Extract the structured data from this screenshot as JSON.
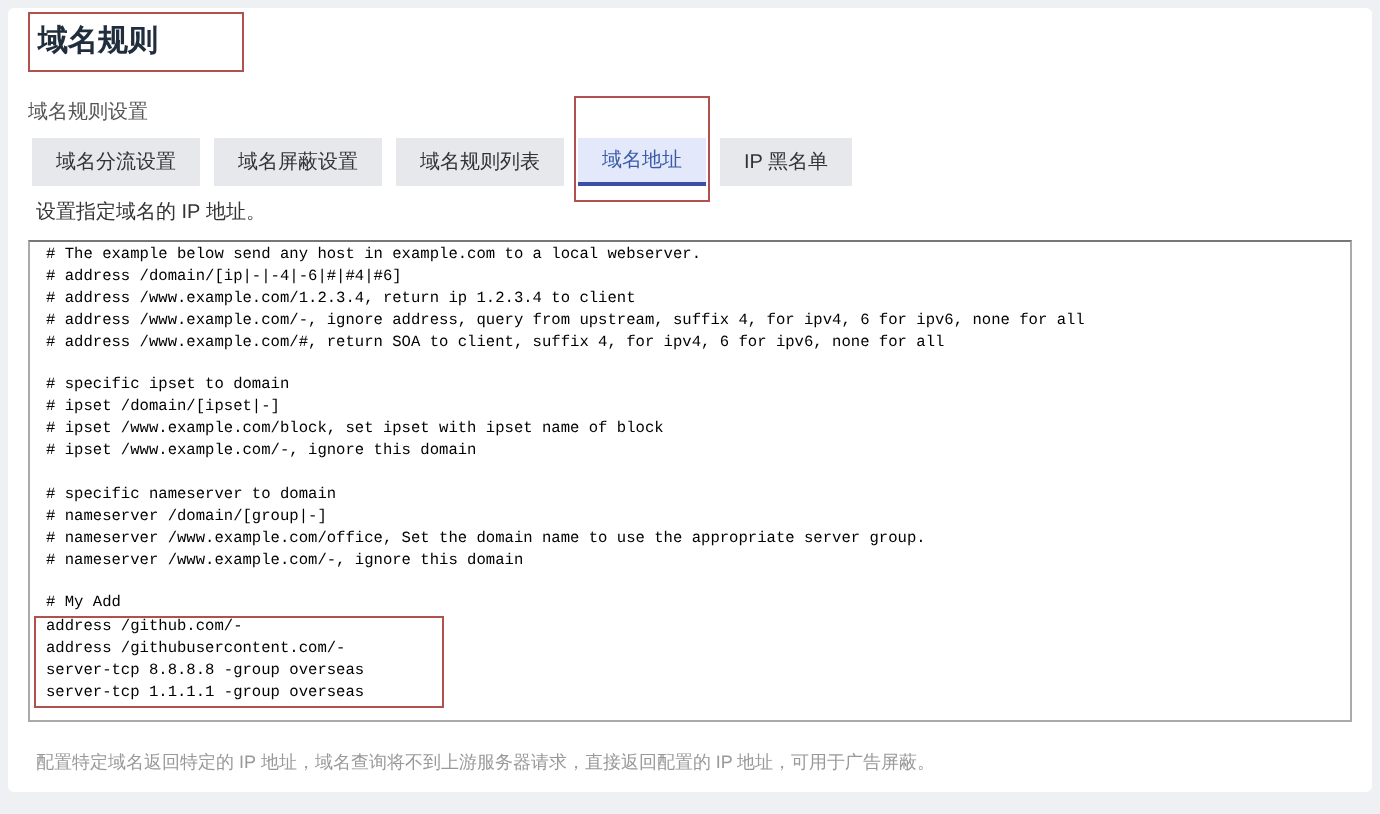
{
  "title": {
    "text": "域名规则",
    "annotated": true
  },
  "section_label": "域名规则设置",
  "tabs": [
    {
      "label": "域名分流设置",
      "selected": false,
      "annotated": false
    },
    {
      "label": "域名屏蔽设置",
      "selected": false,
      "annotated": false
    },
    {
      "label": "域名规则列表",
      "selected": false,
      "annotated": false
    },
    {
      "label": "域名地址",
      "selected": true,
      "annotated": true
    },
    {
      "label": "IP 黑名单",
      "selected": false,
      "annotated": false
    }
  ],
  "description": "设置指定域名的 IP 地址。",
  "editor": {
    "blocks": [
      {
        "blank_line_before": false,
        "annotated": false,
        "lines": [
          "# The example below send any host in example.com to a local webserver.",
          "# address /domain/[ip|-|-4|-6|#|#4|#6]",
          "# address /www.example.com/1.2.3.4, return ip 1.2.3.4 to client",
          "# address /www.example.com/-, ignore address, query from upstream, suffix 4, for ipv4, 6 for ipv6, none for all",
          "# address /www.example.com/#, return SOA to client, suffix 4, for ipv4, 6 for ipv6, none for all"
        ]
      },
      {
        "blank_line_before": true,
        "annotated": false,
        "lines": [
          "# specific ipset to domain",
          "# ipset /domain/[ipset|-]",
          "# ipset /www.example.com/block, set ipset with ipset name of block",
          "# ipset /www.example.com/-, ignore this domain"
        ]
      },
      {
        "blank_line_before": true,
        "annotated": false,
        "lines": [
          "# specific nameserver to domain",
          "# nameserver /domain/[group|-]",
          "# nameserver /www.example.com/office, Set the domain name to use the appropriate server group.",
          "# nameserver /www.example.com/-, ignore this domain"
        ]
      },
      {
        "blank_line_before": true,
        "annotated": false,
        "lines": [
          "# My Add"
        ]
      },
      {
        "blank_line_before": false,
        "annotated": true,
        "lines": [
          "address /github.com/-",
          "address /githubusercontent.com/-",
          "server-tcp 8.8.8.8 -group overseas",
          "server-tcp 1.1.1.1 -group overseas"
        ]
      }
    ]
  },
  "hint": "配置特定域名返回特定的 IP 地址，域名查询将不到上游服务器请求，直接返回配置的 IP 地址，可用于广告屏蔽。"
}
